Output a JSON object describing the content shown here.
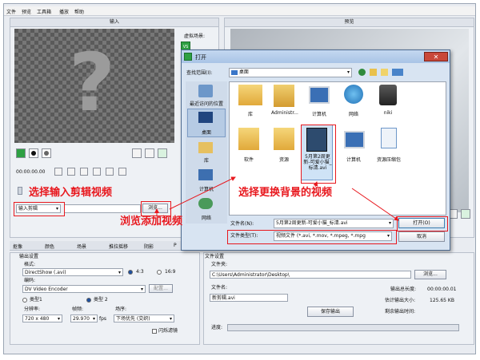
{
  "menu": [
    "文件",
    "预览",
    "工具箱",
    "播放",
    "帮助"
  ],
  "input_panel": {
    "title": "输入",
    "timecode": "00:00:00.00"
  },
  "virtual_scene": {
    "title": "虚拟场景:"
  },
  "preview_panel": {
    "title": "预览"
  },
  "input_clip": {
    "label": "输入剪辑",
    "browse": "浏览..."
  },
  "tabs": [
    "抠像",
    "颜色",
    "场景",
    "推拉摇移",
    "阴影",
    "P"
  ],
  "output_settings": {
    "title": "输出设置",
    "format_label": "格式:",
    "format_value": "DirectShow (.avi)",
    "aspect_43": "4:3",
    "aspect_169": "16:9",
    "codec_label": "编码:",
    "codec_value": "DV Video Encoder",
    "config": "配置...",
    "type1": "类型1",
    "type2": "类型 2",
    "resolution_label": "分辨率:",
    "resolution_value": "720 x 480",
    "framerate_label": "帧频:",
    "framerate_value": "29.970",
    "fps": "fps",
    "field_label": "场序:",
    "field_value": "下场优先 (交织)",
    "deinterlace": "闪烁滤镜"
  },
  "file_settings": {
    "title": "文件设置",
    "folder_label": "文件夹:",
    "folder_value": "C:\\Users\\Administrator\\Desktop\\",
    "browse": "浏览...",
    "filename_label": "文件名:",
    "filename_value": "新剪辑.avi",
    "total_length_label": "输出总长度:",
    "total_length_value": "00:00:00.01",
    "est_size_label": "估计输出大小:",
    "est_size_value": "125.65 KB",
    "remaining_label": "剩余输出时间:",
    "save_output": "保存输出",
    "progress_label": "进度:"
  },
  "dialog": {
    "title": "打开",
    "lookin_label": "查找范围(I):",
    "lookin_value": "桌面",
    "places": [
      "最近访问的位置",
      "桌面",
      "库",
      "计算机",
      "网络"
    ],
    "files_row1": [
      "库",
      "Administr...",
      "计算机",
      "网络",
      "niki"
    ],
    "files_row2": [
      "软件",
      "资源",
      "5月第2周更新-可爱小猫_标清.avi",
      "计算机",
      "资源压缩包"
    ],
    "filename_label": "文件名(N):",
    "filename_value": "5月第2周更新-可爱小猫_标清.avi",
    "filetype_label": "文件类型(T):",
    "filetype_value": "视频文件 (*.avi, *.mov, *.mpeg, *.mpg",
    "open": "打开(O)",
    "cancel": "取消"
  },
  "annotations": {
    "select_clip": "选择输入剪辑视频",
    "browse_add": "浏览添加视频",
    "select_bg": "选择更换背景的视频"
  },
  "colors": {
    "accent_red": "#e8181e",
    "dialog_blue": "#4d6a8f"
  }
}
